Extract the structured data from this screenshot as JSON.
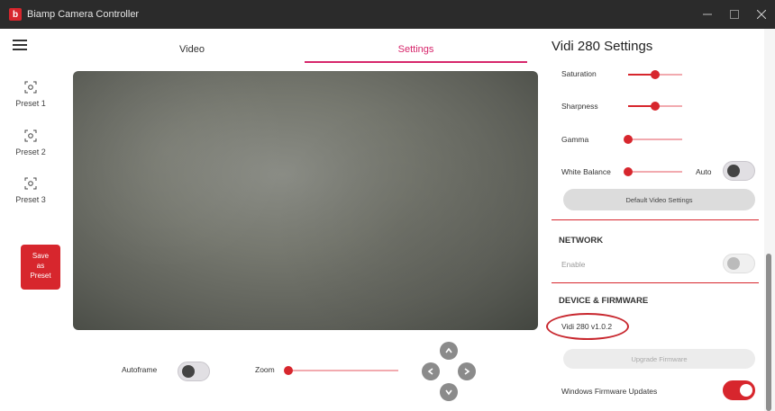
{
  "window": {
    "title": "Biamp Camera Controller",
    "logo_letter": "b"
  },
  "left_panel": {
    "presets": [
      {
        "label": "Preset 1"
      },
      {
        "label": "Preset 2"
      },
      {
        "label": "Preset 3"
      }
    ],
    "save_button": {
      "line1": "Save",
      "line2": "as",
      "line3": "Preset"
    }
  },
  "tabs": {
    "video": "Video",
    "settings": "Settings",
    "active": "Settings"
  },
  "video_controls": {
    "autoframe_label": "Autoframe",
    "autoframe_on": false,
    "zoom_label": "Zoom",
    "zoom_level": 0.0
  },
  "settings": {
    "title": "Vidi 280 Settings",
    "saturation": {
      "label": "Saturation",
      "value": 0.5
    },
    "sharpness": {
      "label": "Sharpness",
      "value": 0.5
    },
    "gamma": {
      "label": "Gamma",
      "value": 0.0
    },
    "white_balance": {
      "label": "White Balance",
      "value": 0.0,
      "auto_label": "Auto",
      "auto_on": false
    },
    "default_button": "Default Video Settings",
    "network": {
      "heading": "NETWORK",
      "enable_label": "Enable",
      "enabled": false
    },
    "device": {
      "heading": "DEVICE & FIRMWARE",
      "version": "Vidi 280 v1.0.2",
      "upgrade_button": "Upgrade Firmware",
      "windows_updates_label": "Windows Firmware Updates",
      "windows_updates_on": true
    }
  },
  "colors": {
    "accent": "#d7262d",
    "tab_active": "#d7266b",
    "titlebar": "#2b2b2b"
  }
}
